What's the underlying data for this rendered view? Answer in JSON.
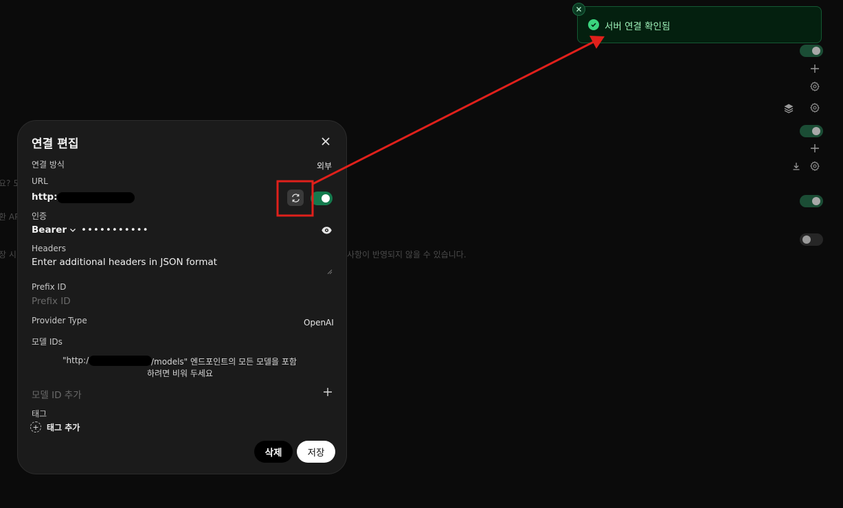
{
  "background": {
    "fragments": {
      "f1": "요? 도",
      "f2": "환 AP",
      "f3": "장 시",
      "f4": "사항이 반영되지 않을 수 있습니다."
    }
  },
  "modal": {
    "title": "연결 편집",
    "connection_type": {
      "label": "연결 방식",
      "value": "외부"
    },
    "url": {
      "label": "URL",
      "value": "http:/.",
      "enabled": true
    },
    "auth": {
      "label": "인증",
      "type": "Bearer",
      "key_masked": "•••••••••••"
    },
    "headers": {
      "label": "Headers",
      "placeholder": "Enter additional headers in JSON format"
    },
    "prefix_id": {
      "label": "Prefix ID",
      "placeholder": "Prefix ID"
    },
    "provider_type": {
      "label": "Provider Type",
      "value": "OpenAI"
    },
    "model_ids": {
      "label": "모델 IDs",
      "hint_prefix": "\"http:/.",
      "hint_suffix": "/models\" 엔드포인트의 모든 모델을 포함",
      "hint_line2": "하려면 비워 두세요",
      "add_placeholder": "모델 ID 추가"
    },
    "tags": {
      "label": "태그",
      "add_label": "태그 추가"
    },
    "buttons": {
      "delete": "삭제",
      "save": "저장"
    }
  },
  "toast": {
    "message": "서버 연결 확인됨",
    "status": "success"
  },
  "colors": {
    "accent_green": "#147a4d",
    "toast_bg": "#04200f",
    "toast_text": "#9ef0b8",
    "annotation_red": "#e0201b"
  },
  "icons": {
    "close": "close-icon",
    "sync": "refresh-icon",
    "eye": "eye-icon",
    "plus": "plus-icon",
    "check": "check-circle-icon",
    "gear": "gear-icon",
    "layers": "layers-icon",
    "download": "download-icon"
  }
}
